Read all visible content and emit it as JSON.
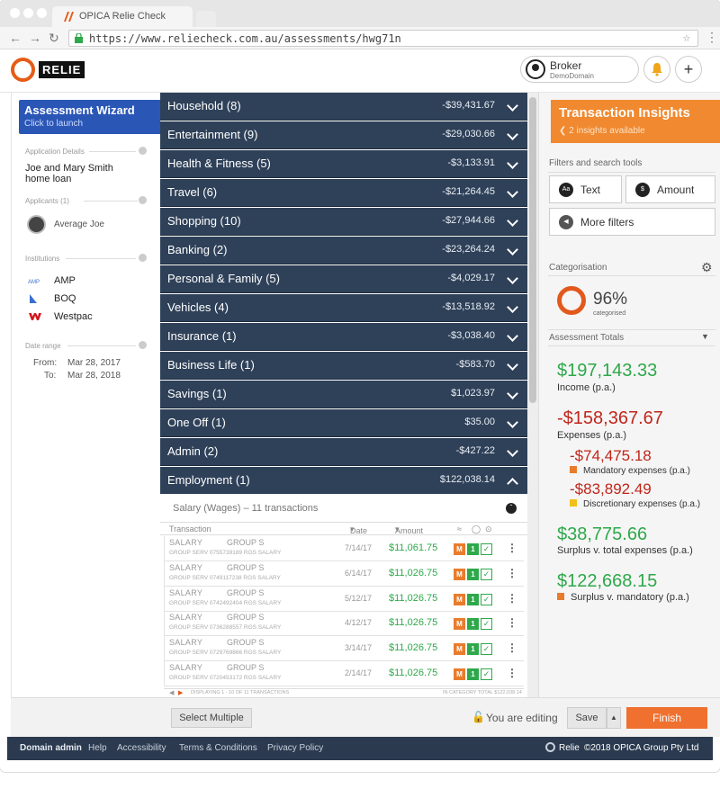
{
  "browser": {
    "tab_title": "OPICA Relie Check",
    "url": "https://www.reliecheck.com.au/assessments/hwg71n"
  },
  "header": {
    "logo_text": "RELIE",
    "user_name": "Broker",
    "user_domain": "DemoDomain"
  },
  "wizard": {
    "title": "Assessment Wizard",
    "subtitle": "Click to launch"
  },
  "left": {
    "app_details_label": "Application Details",
    "app_name": "Joe and Mary Smith home loan",
    "applicants_label": "Applicants (1)",
    "applicant": "Average Joe",
    "institutions_label": "Institutions",
    "institutions": [
      "AMP",
      "BOQ",
      "Westpac"
    ],
    "date_range_label": "Date range",
    "from_label": "From:",
    "from": "Mar 28, 2017",
    "to_label": "To:",
    "to": "Mar 28, 2018"
  },
  "categories": [
    {
      "name": "Household (8)",
      "value": "-$39,431.67"
    },
    {
      "name": "Entertainment (9)",
      "value": "-$29,030.66"
    },
    {
      "name": "Health & Fitness (5)",
      "value": "-$3,133.91"
    },
    {
      "name": "Travel (6)",
      "value": "-$21,264.45"
    },
    {
      "name": "Shopping (10)",
      "value": "-$27,944.66"
    },
    {
      "name": "Banking (2)",
      "value": "-$23,264.24"
    },
    {
      "name": "Personal & Family (5)",
      "value": "-$4,029.17"
    },
    {
      "name": "Vehicles (4)",
      "value": "-$13,518.92"
    },
    {
      "name": "Insurance (1)",
      "value": "-$3,038.40"
    },
    {
      "name": "Business Life (1)",
      "value": "-$583.70"
    },
    {
      "name": "Savings (1)",
      "value": "$1,023.97"
    },
    {
      "name": "One Off (1)",
      "value": "$35.00"
    },
    {
      "name": "Admin (2)",
      "value": "-$427.22"
    },
    {
      "name": "Employment (1)",
      "value": "$122,038.14"
    }
  ],
  "sub": {
    "title": "Salary (Wages) – 11 transactions"
  },
  "table": {
    "col_transaction": "Transaction",
    "col_date": "Date",
    "col_amount": "Amount",
    "badge_m": "M",
    "badge_1": "1",
    "footer_left": "DISPLAYING 1 - 10 OF 11 TRANSACTIONS",
    "footer_right": "IN CATEGORY TOTAL $122,038.14",
    "rows": [
      {
        "t1": "SALARY",
        "t2": "GROUP S",
        "ref": "GROUP SERV 0755739189 RGS SALARY",
        "date": "7/14/17",
        "amount": "$11,061.75"
      },
      {
        "t1": "SALARY",
        "t2": "GROUP S",
        "ref": "GROUP SERV 0749117238 RGS SALARY",
        "date": "6/14/17",
        "amount": "$11,026.75"
      },
      {
        "t1": "SALARY",
        "t2": "GROUP S",
        "ref": "GROUP SERV 0742492404 RGS SALARY",
        "date": "5/12/17",
        "amount": "$11,026.75"
      },
      {
        "t1": "SALARY",
        "t2": "GROUP S",
        "ref": "GROUP SERV 0736288557 RGS SALARY",
        "date": "4/12/17",
        "amount": "$11,026.75"
      },
      {
        "t1": "SALARY",
        "t2": "GROUP S",
        "ref": "GROUP SERV 0729769866 RGS SALARY",
        "date": "3/14/17",
        "amount": "$11,026.75"
      },
      {
        "t1": "SALARY",
        "t2": "GROUP S",
        "ref": "GROUP SERV 0720453172 RGS SALARY",
        "date": "2/14/17",
        "amount": "$11,026.75"
      }
    ]
  },
  "insights": {
    "title": "Transaction Insights",
    "subtitle": "2 insights available",
    "filters_label": "Filters and search tools",
    "text_btn": "Text",
    "text_icon": "Aa",
    "amount_btn": "Amount",
    "more_filters": "More filters",
    "categorisation_label": "Categorisation",
    "pct": "96%",
    "pct_label": "categorised",
    "totals_label": "Assessment Totals",
    "income": "$197,143.33",
    "income_label": "Income (p.a.)",
    "expenses": "-$158,367.67",
    "expenses_label": "Expenses (p.a.)",
    "mandatory": "-$74,475.18",
    "mandatory_label": "Mandatory expenses (p.a.)",
    "discretionary": "-$83,892.49",
    "discretionary_label": "Discretionary expenses (p.a.)",
    "surplus_total": "$38,775.66",
    "surplus_total_label": "Surplus v. total expenses (p.a.)",
    "surplus_mand": "$122,668.15",
    "surplus_mand_label": "Surplus v. mandatory (p.a.)"
  },
  "bottom": {
    "select_multiple": "Select Multiple",
    "editing": "You are editing",
    "save": "Save",
    "finish": "Finish"
  },
  "footer": {
    "links": [
      "Domain admin",
      "Help",
      "Accessibility",
      "Terms & Conditions",
      "Privacy Policy"
    ],
    "brand": "Relie",
    "copyright": "©2018 OPICA Group Pty Ltd"
  },
  "colors": {
    "category_bg": "#2f4159",
    "accent_orange": "#f0892f",
    "positive_green": "#2ea84a",
    "negative_red": "#c0261b",
    "wizard_blue": "#2a56b6"
  }
}
